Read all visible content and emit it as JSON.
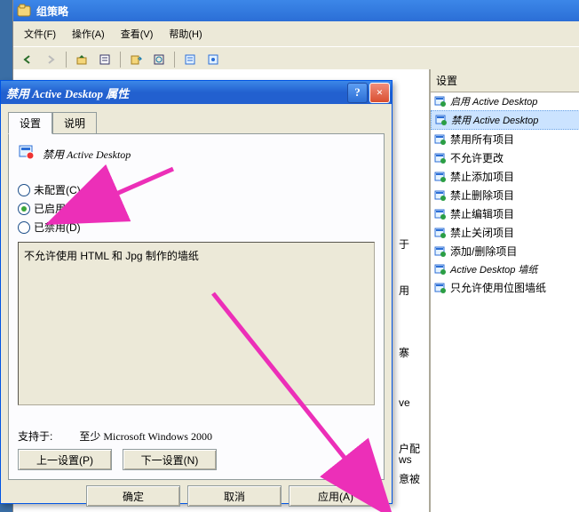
{
  "mmc": {
    "title": "组策略",
    "menu": {
      "file": "文件(F)",
      "action": "操作(A)",
      "view": "查看(V)",
      "help": "帮助(H)"
    }
  },
  "right_panel": {
    "header": "设置",
    "items": [
      {
        "label": "启用 Active Desktop",
        "style": "en"
      },
      {
        "label": "禁用 Active Desktop",
        "style": "en",
        "selected": true
      },
      {
        "label": "禁用所有项目",
        "style": "cn"
      },
      {
        "label": "不允许更改",
        "style": "cn"
      },
      {
        "label": "禁止添加项目",
        "style": "cn"
      },
      {
        "label": "禁止删除项目",
        "style": "cn"
      },
      {
        "label": "禁止编辑项目",
        "style": "cn"
      },
      {
        "label": "禁止关闭项目",
        "style": "cn"
      },
      {
        "label": "添加/删除项目",
        "style": "cn"
      },
      {
        "label": "Active Desktop 墙纸",
        "style": "en"
      },
      {
        "label": "只允许使用位图墙纸",
        "style": "cn"
      }
    ]
  },
  "fragments": {
    "f1": "于",
    "f2": "用",
    "f3": "ve",
    "f4": "户配",
    "f5": "ws",
    "f6": "意被",
    "f7": "寨"
  },
  "dialog": {
    "title": "禁用 Active Desktop 属性",
    "tabs": {
      "settings": "设置",
      "explain": "说明"
    },
    "policy_name": "禁用 Active Desktop",
    "radios": {
      "not_configured": "未配置(C)",
      "enabled": "已启用(E)",
      "disabled": "已禁用(D)"
    },
    "selected_radio": "enabled",
    "description": "不允许使用 HTML 和 Jpg 制作的墙纸",
    "supported_label": "支持于:",
    "supported_value": "至少 Microsoft Windows 2000",
    "prev_btn": "上一设置(P)",
    "next_btn": "下一设置(N)",
    "ok": "确定",
    "cancel": "取消",
    "apply": "应用(A)"
  },
  "icons": {
    "title_icon": "policy-icon",
    "help": "?",
    "close": "×"
  }
}
